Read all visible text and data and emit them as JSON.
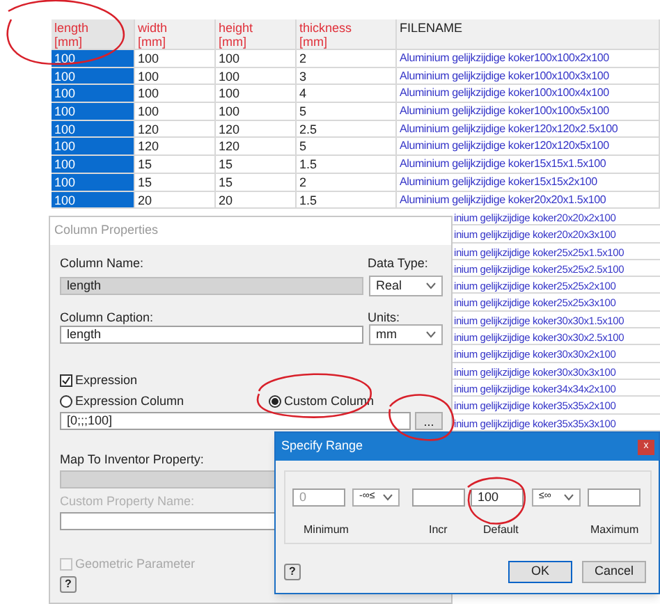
{
  "table": {
    "columns": [
      {
        "name": "length",
        "unit": "[mm]",
        "selected": true
      },
      {
        "name": "width",
        "unit": "[mm]",
        "selected": false
      },
      {
        "name": "height",
        "unit": "[mm]",
        "selected": false
      },
      {
        "name": "thickness",
        "unit": "[mm]",
        "selected": false
      },
      {
        "name": "FILENAME",
        "selected": false
      }
    ],
    "rows": [
      [
        "100",
        "100",
        "100",
        "2",
        "Aluminium gelijkzijdige koker100x100x2x100"
      ],
      [
        "100",
        "100",
        "100",
        "3",
        "Aluminium gelijkzijdige koker100x100x3x100"
      ],
      [
        "100",
        "100",
        "100",
        "4",
        "Aluminium gelijkzijdige koker100x100x4x100"
      ],
      [
        "100",
        "100",
        "100",
        "5",
        "Aluminium gelijkzijdige koker100x100x5x100"
      ],
      [
        "100",
        "120",
        "120",
        "2.5",
        "Aluminium gelijkzijdige koker120x120x2.5x100"
      ],
      [
        "100",
        "120",
        "120",
        "5",
        "Aluminium gelijkzijdige koker120x120x5x100"
      ],
      [
        "100",
        "15",
        "15",
        "1.5",
        "Aluminium gelijkzijdige koker15x15x1.5x100"
      ],
      [
        "100",
        "15",
        "15",
        "2",
        "Aluminium gelijkzijdige koker15x15x2x100"
      ],
      [
        "100",
        "20",
        "20",
        "1.5",
        "Aluminium gelijkzijdige koker20x20x1.5x100"
      ]
    ],
    "visible_filenames": [
      "inium gelijkzijdige koker20x20x2x100",
      "inium gelijkzijdige koker20x20x3x100",
      "inium gelijkzijdige koker25x25x1.5x100",
      "inium gelijkzijdige koker25x25x2.5x100",
      "inium gelijkzijdige koker25x25x2x100",
      "inium gelijkzijdige koker25x25x3x100",
      "inium gelijkzijdige koker30x30x1.5x100",
      "inium gelijkzijdige koker30x30x2.5x100",
      "inium gelijkzijdige koker30x30x2x100",
      "inium gelijkzijdige koker30x30x3x100",
      "inium gelijkzijdige koker34x34x2x100",
      "inium gelijkzijdige koker35x35x2x100",
      "inium gelijkzijdige koker35x35x3x100"
    ]
  },
  "column_properties": {
    "title": "Column Properties",
    "column_name_label": "Column Name:",
    "column_name": {
      "value": "length",
      "disabled": true
    },
    "data_type_label": "Data Type:",
    "data_type": "Real",
    "column_caption_label": "Column Caption:",
    "column_caption": {
      "value": "length",
      "disabled": false
    },
    "units_label": "Units:",
    "units": "mm",
    "expression": {
      "label": "Expression",
      "checked": true
    },
    "radios": [
      {
        "label": "Expression Column",
        "selected": false
      },
      {
        "label": "Custom Column",
        "selected": true
      }
    ],
    "expression_value": "[0;;;100]",
    "browse_button": "...",
    "map_label": "Map To Inventor Property:",
    "custom_property_label": {
      "text": "Custom Property Name:",
      "disabled": true
    },
    "geometric": {
      "label": "Geometric Parameter",
      "checked": false,
      "disabled": true
    },
    "help_button": "?"
  },
  "specify_range": {
    "title": "Specify Range",
    "close": "x",
    "minimum": {
      "placeholder": "0",
      "label": "Minimum"
    },
    "lower_bound": "-∞≤",
    "incr": {
      "label": "Incr"
    },
    "default": {
      "value": "100",
      "label": "Default"
    },
    "upper_bound": "≤∞",
    "maximum": {
      "label": "Maximum"
    },
    "help_button": "?",
    "buttons": [
      {
        "label": "OK",
        "selected": true
      },
      {
        "label": "Cancel",
        "selected": false
      }
    ]
  }
}
